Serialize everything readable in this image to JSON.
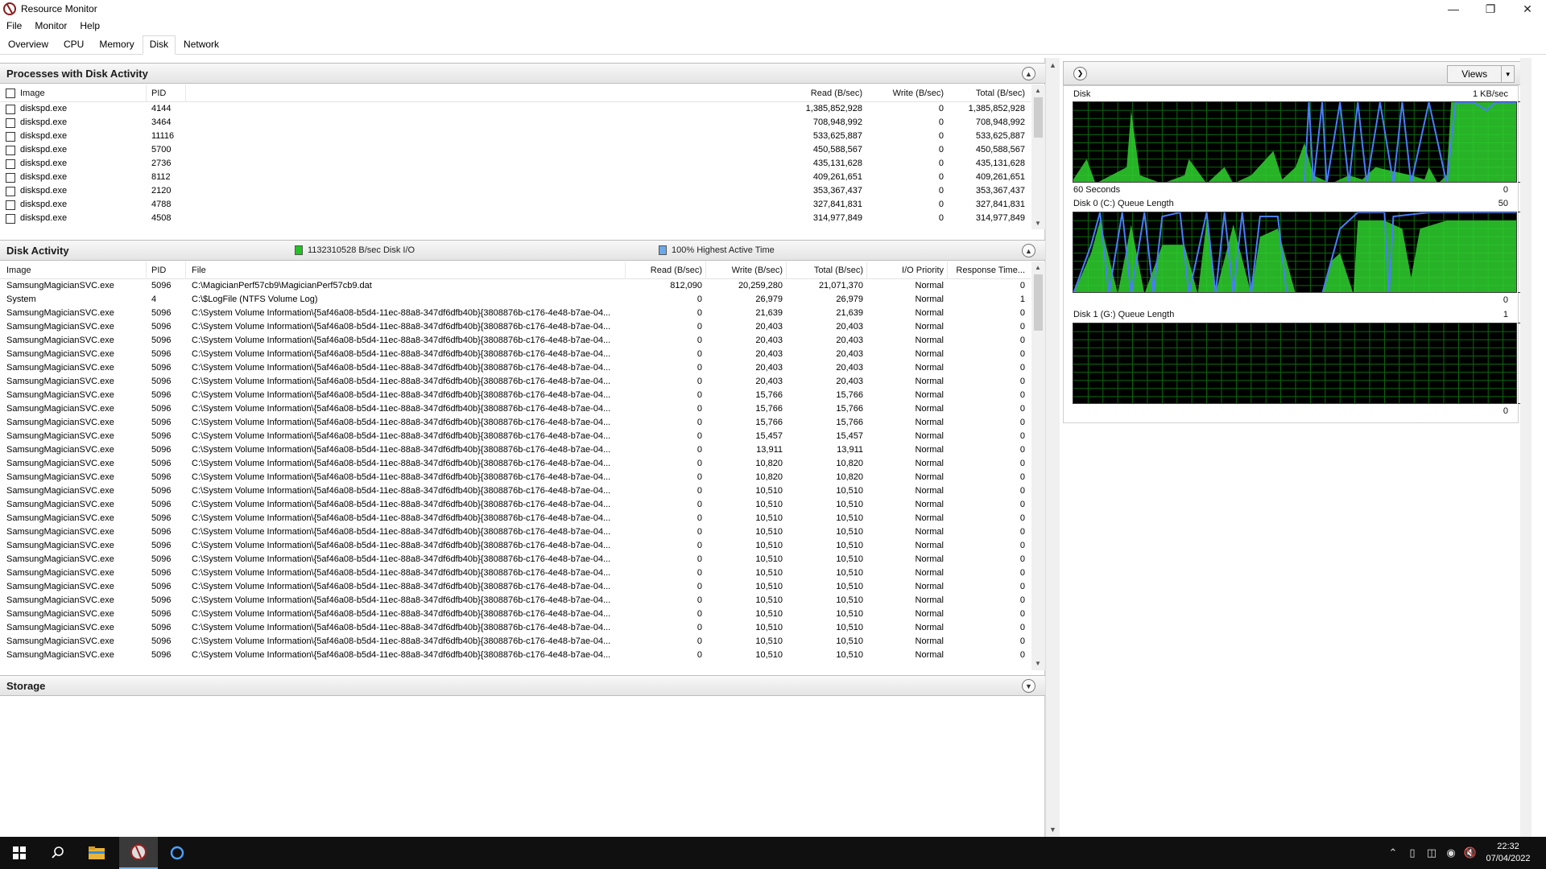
{
  "window": {
    "title": "Resource Monitor"
  },
  "menu": [
    "File",
    "Monitor",
    "Help"
  ],
  "tabs": [
    "Overview",
    "CPU",
    "Memory",
    "Disk",
    "Network"
  ],
  "active_tab": "Disk",
  "processes": {
    "title": "Processes with Disk Activity",
    "columns": [
      "Image",
      "PID",
      "Read (B/sec)",
      "Write (B/sec)",
      "Total (B/sec)"
    ],
    "rows": [
      [
        "diskspd.exe",
        "4144",
        "1,385,852,928",
        "0",
        "1,385,852,928"
      ],
      [
        "diskspd.exe",
        "3464",
        "708,948,992",
        "0",
        "708,948,992"
      ],
      [
        "diskspd.exe",
        "11116",
        "533,625,887",
        "0",
        "533,625,887"
      ],
      [
        "diskspd.exe",
        "5700",
        "450,588,567",
        "0",
        "450,588,567"
      ],
      [
        "diskspd.exe",
        "2736",
        "435,131,628",
        "0",
        "435,131,628"
      ],
      [
        "diskspd.exe",
        "8112",
        "409,261,651",
        "0",
        "409,261,651"
      ],
      [
        "diskspd.exe",
        "2120",
        "353,367,437",
        "0",
        "353,367,437"
      ],
      [
        "diskspd.exe",
        "4788",
        "327,841,831",
        "0",
        "327,841,831"
      ],
      [
        "diskspd.exe",
        "4508",
        "314,977,849",
        "0",
        "314,977,849"
      ]
    ]
  },
  "disk_activity": {
    "title": "Disk Activity",
    "legend_io": "1132310528 B/sec Disk I/O",
    "legend_active": "100% Highest Active Time",
    "columns": [
      "Image",
      "PID",
      "File",
      "Read (B/sec)",
      "Write (B/sec)",
      "Total (B/sec)",
      "I/O Priority",
      "Response Time..."
    ],
    "rows": [
      [
        "SamsungMagicianSVC.exe",
        "5096",
        "C:\\MagicianPerf57cb9\\MagicianPerf57cb9.dat",
        "812,090",
        "20,259,280",
        "21,071,370",
        "Normal",
        "0"
      ],
      [
        "System",
        "4",
        "C:\\$LogFile (NTFS Volume Log)",
        "0",
        "26,979",
        "26,979",
        "Normal",
        "1"
      ],
      [
        "SamsungMagicianSVC.exe",
        "5096",
        "C:\\System Volume Information\\{5af46a08-b5d4-11ec-88a8-347df6dfb40b}{3808876b-c176-4e48-b7ae-04...",
        "0",
        "21,639",
        "21,639",
        "Normal",
        "0"
      ],
      [
        "SamsungMagicianSVC.exe",
        "5096",
        "C:\\System Volume Information\\{5af46a08-b5d4-11ec-88a8-347df6dfb40b}{3808876b-c176-4e48-b7ae-04...",
        "0",
        "20,403",
        "20,403",
        "Normal",
        "0"
      ],
      [
        "SamsungMagicianSVC.exe",
        "5096",
        "C:\\System Volume Information\\{5af46a08-b5d4-11ec-88a8-347df6dfb40b}{3808876b-c176-4e48-b7ae-04...",
        "0",
        "20,403",
        "20,403",
        "Normal",
        "0"
      ],
      [
        "SamsungMagicianSVC.exe",
        "5096",
        "C:\\System Volume Information\\{5af46a08-b5d4-11ec-88a8-347df6dfb40b}{3808876b-c176-4e48-b7ae-04...",
        "0",
        "20,403",
        "20,403",
        "Normal",
        "0"
      ],
      [
        "SamsungMagicianSVC.exe",
        "5096",
        "C:\\System Volume Information\\{5af46a08-b5d4-11ec-88a8-347df6dfb40b}{3808876b-c176-4e48-b7ae-04...",
        "0",
        "20,403",
        "20,403",
        "Normal",
        "0"
      ],
      [
        "SamsungMagicianSVC.exe",
        "5096",
        "C:\\System Volume Information\\{5af46a08-b5d4-11ec-88a8-347df6dfb40b}{3808876b-c176-4e48-b7ae-04...",
        "0",
        "20,403",
        "20,403",
        "Normal",
        "0"
      ],
      [
        "SamsungMagicianSVC.exe",
        "5096",
        "C:\\System Volume Information\\{5af46a08-b5d4-11ec-88a8-347df6dfb40b}{3808876b-c176-4e48-b7ae-04...",
        "0",
        "15,766",
        "15,766",
        "Normal",
        "0"
      ],
      [
        "SamsungMagicianSVC.exe",
        "5096",
        "C:\\System Volume Information\\{5af46a08-b5d4-11ec-88a8-347df6dfb40b}{3808876b-c176-4e48-b7ae-04...",
        "0",
        "15,766",
        "15,766",
        "Normal",
        "0"
      ],
      [
        "SamsungMagicianSVC.exe",
        "5096",
        "C:\\System Volume Information\\{5af46a08-b5d4-11ec-88a8-347df6dfb40b}{3808876b-c176-4e48-b7ae-04...",
        "0",
        "15,766",
        "15,766",
        "Normal",
        "0"
      ],
      [
        "SamsungMagicianSVC.exe",
        "5096",
        "C:\\System Volume Information\\{5af46a08-b5d4-11ec-88a8-347df6dfb40b}{3808876b-c176-4e48-b7ae-04...",
        "0",
        "15,457",
        "15,457",
        "Normal",
        "0"
      ],
      [
        "SamsungMagicianSVC.exe",
        "5096",
        "C:\\System Volume Information\\{5af46a08-b5d4-11ec-88a8-347df6dfb40b}{3808876b-c176-4e48-b7ae-04...",
        "0",
        "13,911",
        "13,911",
        "Normal",
        "0"
      ],
      [
        "SamsungMagicianSVC.exe",
        "5096",
        "C:\\System Volume Information\\{5af46a08-b5d4-11ec-88a8-347df6dfb40b}{3808876b-c176-4e48-b7ae-04...",
        "0",
        "10,820",
        "10,820",
        "Normal",
        "0"
      ],
      [
        "SamsungMagicianSVC.exe",
        "5096",
        "C:\\System Volume Information\\{5af46a08-b5d4-11ec-88a8-347df6dfb40b}{3808876b-c176-4e48-b7ae-04...",
        "0",
        "10,820",
        "10,820",
        "Normal",
        "0"
      ],
      [
        "SamsungMagicianSVC.exe",
        "5096",
        "C:\\System Volume Information\\{5af46a08-b5d4-11ec-88a8-347df6dfb40b}{3808876b-c176-4e48-b7ae-04...",
        "0",
        "10,510",
        "10,510",
        "Normal",
        "0"
      ],
      [
        "SamsungMagicianSVC.exe",
        "5096",
        "C:\\System Volume Information\\{5af46a08-b5d4-11ec-88a8-347df6dfb40b}{3808876b-c176-4e48-b7ae-04...",
        "0",
        "10,510",
        "10,510",
        "Normal",
        "0"
      ],
      [
        "SamsungMagicianSVC.exe",
        "5096",
        "C:\\System Volume Information\\{5af46a08-b5d4-11ec-88a8-347df6dfb40b}{3808876b-c176-4e48-b7ae-04...",
        "0",
        "10,510",
        "10,510",
        "Normal",
        "0"
      ],
      [
        "SamsungMagicianSVC.exe",
        "5096",
        "C:\\System Volume Information\\{5af46a08-b5d4-11ec-88a8-347df6dfb40b}{3808876b-c176-4e48-b7ae-04...",
        "0",
        "10,510",
        "10,510",
        "Normal",
        "0"
      ],
      [
        "SamsungMagicianSVC.exe",
        "5096",
        "C:\\System Volume Information\\{5af46a08-b5d4-11ec-88a8-347df6dfb40b}{3808876b-c176-4e48-b7ae-04...",
        "0",
        "10,510",
        "10,510",
        "Normal",
        "0"
      ],
      [
        "SamsungMagicianSVC.exe",
        "5096",
        "C:\\System Volume Information\\{5af46a08-b5d4-11ec-88a8-347df6dfb40b}{3808876b-c176-4e48-b7ae-04...",
        "0",
        "10,510",
        "10,510",
        "Normal",
        "0"
      ],
      [
        "SamsungMagicianSVC.exe",
        "5096",
        "C:\\System Volume Information\\{5af46a08-b5d4-11ec-88a8-347df6dfb40b}{3808876b-c176-4e48-b7ae-04...",
        "0",
        "10,510",
        "10,510",
        "Normal",
        "0"
      ],
      [
        "SamsungMagicianSVC.exe",
        "5096",
        "C:\\System Volume Information\\{5af46a08-b5d4-11ec-88a8-347df6dfb40b}{3808876b-c176-4e48-b7ae-04...",
        "0",
        "10,510",
        "10,510",
        "Normal",
        "0"
      ],
      [
        "SamsungMagicianSVC.exe",
        "5096",
        "C:\\System Volume Information\\{5af46a08-b5d4-11ec-88a8-347df6dfb40b}{3808876b-c176-4e48-b7ae-04...",
        "0",
        "10,510",
        "10,510",
        "Normal",
        "0"
      ],
      [
        "SamsungMagicianSVC.exe",
        "5096",
        "C:\\System Volume Information\\{5af46a08-b5d4-11ec-88a8-347df6dfb40b}{3808876b-c176-4e48-b7ae-04...",
        "0",
        "10,510",
        "10,510",
        "Normal",
        "0"
      ],
      [
        "SamsungMagicianSVC.exe",
        "5096",
        "C:\\System Volume Information\\{5af46a08-b5d4-11ec-88a8-347df6dfb40b}{3808876b-c176-4e48-b7ae-04...",
        "0",
        "10,510",
        "10,510",
        "Normal",
        "0"
      ],
      [
        "SamsungMagicianSVC.exe",
        "5096",
        "C:\\System Volume Information\\{5af46a08-b5d4-11ec-88a8-347df6dfb40b}{3808876b-c176-4e48-b7ae-04...",
        "0",
        "10,510",
        "10,510",
        "Normal",
        "0"
      ],
      [
        "SamsungMagicianSVC.exe",
        "5096",
        "C:\\System Volume Information\\{5af46a08-b5d4-11ec-88a8-347df6dfb40b}{3808876b-c176-4e48-b7ae-04...",
        "0",
        "10,510",
        "10,510",
        "Normal",
        "0"
      ]
    ]
  },
  "storage": {
    "title": "Storage"
  },
  "graphs": {
    "views_label": "Views",
    "disk": {
      "title": "Disk",
      "max": "1 KB/sec",
      "time": "60 Seconds",
      "min": "0"
    },
    "disk0": {
      "title": "Disk 0 (C:) Queue Length",
      "max": "50",
      "min": "0"
    },
    "disk1": {
      "title": "Disk 1 (G:) Queue Length",
      "max": "1",
      "min": "0"
    }
  },
  "colors": {
    "graph_green": "#2fd12f",
    "graph_blue": "#4a7dff",
    "io_legend": "#22c322",
    "active_legend": "#6aa8e8"
  },
  "taskbar": {
    "items": [
      "windows-start",
      "search",
      "file-explorer",
      "resource-monitor",
      "cortana"
    ],
    "time": "22:32",
    "date": "07/04/2022"
  }
}
